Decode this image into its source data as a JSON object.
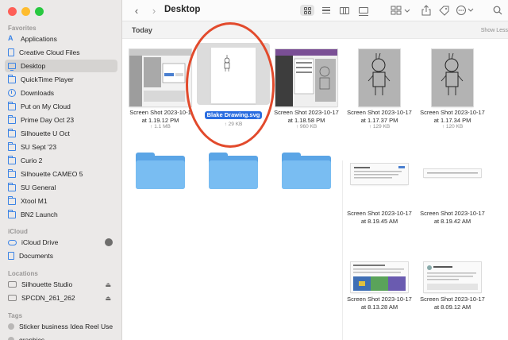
{
  "window": {
    "title": "Desktop",
    "nav_back_glyph": "‹",
    "nav_fwd_glyph": "›"
  },
  "sidebar": {
    "favorites_label": "Favorites",
    "favorites": [
      {
        "label": "Applications",
        "icon": "applications-icon"
      },
      {
        "label": "Creative Cloud Files",
        "icon": "document-icon"
      },
      {
        "label": "Desktop",
        "icon": "desktop-icon",
        "selected": true
      },
      {
        "label": "QuickTime Player",
        "icon": "folder-icon"
      },
      {
        "label": "Downloads",
        "icon": "download-icon"
      },
      {
        "label": "Put on My Cloud",
        "icon": "folder-icon"
      },
      {
        "label": "Prime Day Oct 23",
        "icon": "folder-icon"
      },
      {
        "label": "Silhouette U Oct",
        "icon": "folder-icon"
      },
      {
        "label": "SU Sept '23",
        "icon": "folder-icon"
      },
      {
        "label": "Curio 2",
        "icon": "folder-icon"
      },
      {
        "label": "Silhouette CAMEO 5",
        "icon": "folder-icon"
      },
      {
        "label": "SU General",
        "icon": "folder-icon"
      },
      {
        "label": "Xtool M1",
        "icon": "folder-icon"
      },
      {
        "label": "BN2 Launch",
        "icon": "folder-icon"
      }
    ],
    "icloud_label": "iCloud",
    "icloud": [
      {
        "label": "iCloud Drive",
        "icon": "cloud-icon"
      },
      {
        "label": "Documents",
        "icon": "document-icon"
      }
    ],
    "locations_label": "Locations",
    "locations": [
      {
        "label": "Silhouette Studio",
        "icon": "disk-icon",
        "eject": "⏏"
      },
      {
        "label": "SPCDN_261_262",
        "icon": "disk-icon",
        "eject": "⏏"
      }
    ],
    "tags_label": "Tags",
    "tags": [
      {
        "label": "Sticker business Idea Reel Use",
        "icon": "tag-icon"
      },
      {
        "label": "graphics",
        "icon": "tag-icon"
      }
    ]
  },
  "content": {
    "section_title": "Today",
    "show_less": "Show Less",
    "files": [
      {
        "name_line1": "Screen Shot 2023-10-1",
        "name_line2": "at 1.19.12 PM",
        "size": "↑ 1.1 MB",
        "kind": "screenshot-ui"
      },
      {
        "name_line1": "Blake Drawing.svg",
        "name_line2": "",
        "size": "↑ 29 KB",
        "kind": "svg-drawing",
        "selected": true
      },
      {
        "name_line1": "Screen Shot 2023-10-17",
        "name_line2": "at 1.18.58 PM",
        "size": "↑ 960 KB",
        "kind": "screenshot-ui2"
      },
      {
        "name_line1": "Screen Shot 2023-10-17",
        "name_line2": "at 1.17.37 PM",
        "size": "↑ 129 KB",
        "kind": "robot"
      },
      {
        "name_line1": "Screen Shot 2023-10-17",
        "name_line2": "at 1.17.34 PM",
        "size": "↑ 120 KB",
        "kind": "robot"
      }
    ],
    "folders": [
      {
        "name": ""
      },
      {
        "name": ""
      },
      {
        "name": ""
      }
    ],
    "shots": [
      {
        "name_line1": "Screen Shot 2023-10-17",
        "name_line2": "at 8.19.45 AM"
      },
      {
        "name_line1": "Screen Shot 2023-10-17",
        "name_line2": "at 8.19.42 AM"
      },
      {
        "name_line1": "Screen Shot 2023-10-17",
        "name_line2": "at 8.13.28 AM"
      },
      {
        "name_line1": "Screen Shot 2023-10-17",
        "name_line2": "at 8.09.12 AM"
      }
    ]
  },
  "colors": {
    "selection": "#2a6de0",
    "annotation": "#e24a2c",
    "folder": "#79bdf2"
  }
}
